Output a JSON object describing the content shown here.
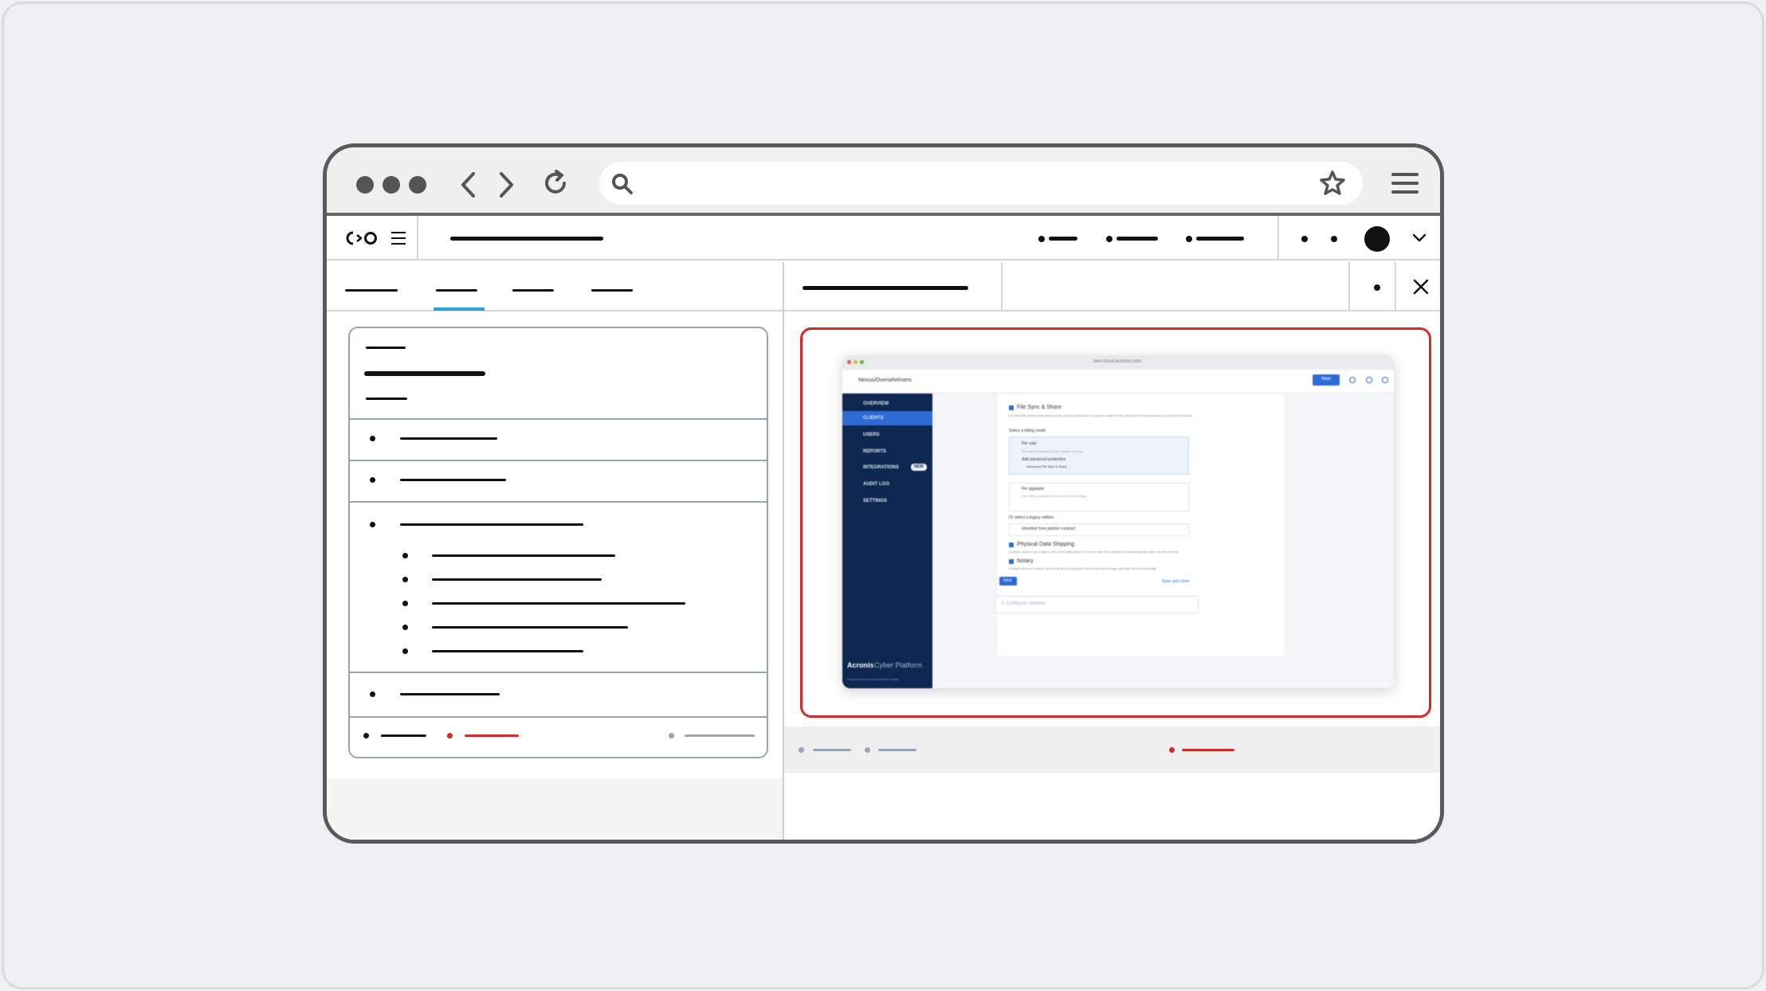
{
  "preview": {
    "header_title": "Nexus/Overwhelmers",
    "new_button": "New",
    "sidebar": [
      {
        "label": "OVERVIEW"
      },
      {
        "label": "CLIENTS"
      },
      {
        "label": "USERS"
      },
      {
        "label": "REPORTS"
      },
      {
        "label": "INTEGRATIONS",
        "badge": "NEW"
      },
      {
        "label": "AUDIT LOG"
      },
      {
        "label": "SETTINGS"
      }
    ],
    "brand": "Acronis",
    "brand_suffix": "Cyber Platform",
    "powered_by": "Powered by Acronis AnyData Engine",
    "form": {
      "file_sync": "File Sync & Share",
      "file_sync_desc": "Provides file sharing that allows users to store and share encrypted content in the cloud, and to synchronize it across their devices.",
      "billing_mode": "Select a billing mode",
      "per_user": "Per user",
      "per_user_desc": "The billing is based on the number of users.",
      "adv_protection": "Add advanced protection",
      "adv_file_sync": "Advanced File Sync & Share",
      "per_gigabyte": "Per gigabyte",
      "per_gigabyte_desc": "The billing is based on the used cloud storage.",
      "legacy": "Or select a legacy edition",
      "legacy_value": "Inherited from partner contract",
      "physical": "Physical Data Shipping",
      "physical_desc": "Enables users to send data to the cloud data center on a hard disk drive instead of transferring the data over the internet.",
      "notary": "Notary",
      "notary_desc": "Enables users to notarize and verify files by using the Blockchain technology, and sign files electronically.",
      "next": "Next",
      "save_close": "Save and close",
      "step3": "3. Configure services"
    },
    "address": "dev-cloud.acronis.com"
  }
}
